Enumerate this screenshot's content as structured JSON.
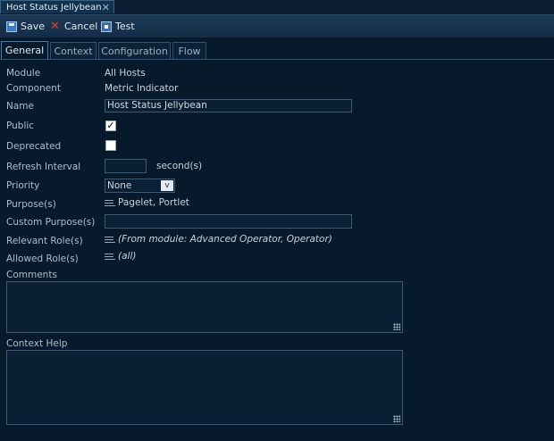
{
  "window": {
    "tab_title": "Host Status Jellybean",
    "close_glyph": "✕"
  },
  "toolbar": {
    "save_label": "Save",
    "cancel_label": "Cancel",
    "test_label": "Test"
  },
  "tabs": [
    {
      "label": "General"
    },
    {
      "label": "Context"
    },
    {
      "label": "Configuration"
    },
    {
      "label": "Flow"
    }
  ],
  "form": {
    "module": {
      "label": "Module",
      "value": "All Hosts"
    },
    "component": {
      "label": "Component",
      "value": "Metric Indicator"
    },
    "name": {
      "label": "Name",
      "value": "Host Status Jellybean"
    },
    "public": {
      "label": "Public",
      "checked": true,
      "mark": "✓"
    },
    "deprecated": {
      "label": "Deprecated",
      "checked": false
    },
    "refresh_interval": {
      "label": "Refresh Interval",
      "value": "",
      "unit": "second(s)"
    },
    "priority": {
      "label": "Priority",
      "value": "None",
      "arrow": "v"
    },
    "purposes": {
      "label": "Purpose(s)",
      "value": "Pagelet, Portlet"
    },
    "custom_purposes": {
      "label": "Custom Purpose(s)",
      "value": ""
    },
    "relevant_roles": {
      "label": "Relevant Role(s)",
      "value": "(From module: Advanced Operator, Operator)"
    },
    "allowed_roles": {
      "label": "Allowed Role(s)",
      "value": "(all)"
    },
    "comments": {
      "label": "Comments",
      "value": ""
    },
    "context_help": {
      "label": "Context Help",
      "value": ""
    }
  },
  "icons": {
    "save": "save-icon",
    "cancel": "cancel-icon",
    "test": "test-icon",
    "list": "list-icon",
    "resize": "resize-grip-icon"
  },
  "colors": {
    "background": "#071a2c",
    "toolbar": "#1d3a57",
    "cancel_red": "#e23a2f",
    "field_border": "#3a5a78"
  }
}
